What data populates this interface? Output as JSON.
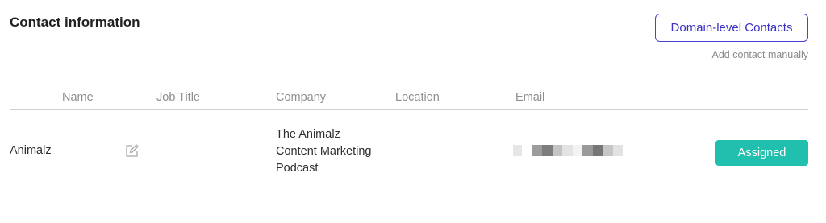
{
  "section": {
    "title": "Contact information",
    "domain_contacts_button": "Domain-level Contacts",
    "add_contact_link": "Add contact manually"
  },
  "table": {
    "columns": [
      "Name",
      "Job Title",
      "Company",
      "Location",
      "Email"
    ],
    "rows": [
      {
        "name": "Animalz",
        "job_title": "",
        "company_lines": [
          "The Animalz",
          "Content Marketing",
          "Podcast"
        ],
        "location": "",
        "email": "",
        "status_button": "Assigned"
      }
    ]
  },
  "colors": {
    "accent_border": "#4b3fd6",
    "assigned": "#20bfae",
    "header_text": "#8e8e8e",
    "rule": "#cfcfcf"
  },
  "icons": {
    "edit": "edit-icon"
  }
}
